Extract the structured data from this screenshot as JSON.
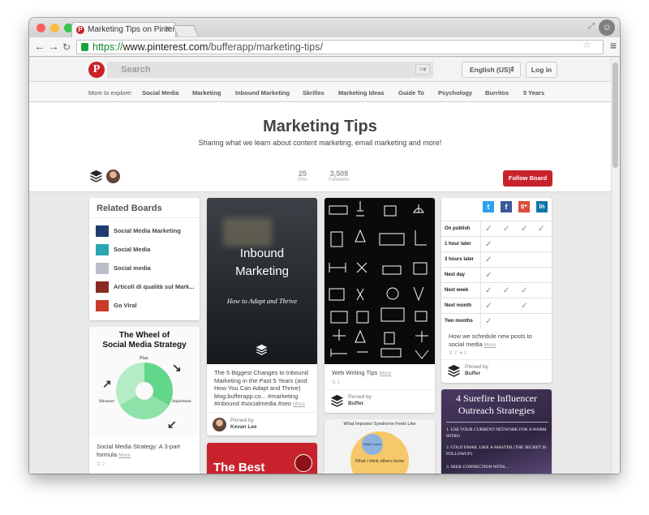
{
  "browser": {
    "tab_title": "Marketing Tips on Pinterest",
    "url_scheme": "https://",
    "url_host": "www.pinterest.com",
    "url_path": "/bufferapp/marketing-tips/"
  },
  "pinterest": {
    "logo": "P",
    "search_placeholder": "Search",
    "language": "English (US)",
    "login_label": "Log in",
    "explore_label": "More to explore:",
    "explore_items": [
      "Social Media",
      "Marketing",
      "Inbound Marketing",
      "Skrillex",
      "Marketing Ideas",
      "Guide To",
      "Psychology",
      "Burritos",
      "5 Years"
    ]
  },
  "board": {
    "title": "Marketing Tips",
    "description": "Sharing what we learn about content marketing, email marketing and more!",
    "pins_count": "25",
    "pins_label": "Pins",
    "followers_count": "3,508",
    "followers_label": "Followers",
    "follow_label": "Follow Board"
  },
  "related": {
    "title": "Related Boards",
    "items": [
      {
        "label": "Social Media Marketing",
        "thumb_color": "#1e3c72"
      },
      {
        "label": "Social Media",
        "thumb_color": "#2aa6b2"
      },
      {
        "label": "Social media",
        "thumb_color": "#b8bfc9"
      },
      {
        "label": "Articoli di qualità sul Mark...",
        "thumb_color": "#8a2a22"
      },
      {
        "label": "Go Viral",
        "thumb_color": "#c83a2a"
      }
    ]
  },
  "wheel": {
    "title_line1": "The Wheel of",
    "title_line2": "Social Media Strategy",
    "plan": "Plan",
    "measure": "Measure",
    "implement": "Implement",
    "caption": "Social Media Strategy: A 3-part formula",
    "more": "More",
    "repins": "2"
  },
  "inbound": {
    "line1": "Inbound",
    "line2": "Marketing",
    "line3": "How to Adapt and Thrive",
    "caption": "The 5 Biggest Changes to Inbound Marketing in the Past 5 Years (and How You Can Adapt and Thrive) blog.bufferapp.co... #marketing #inbound #socialmedia #seo",
    "more": "More",
    "pinned_by": "Pinned by",
    "pinner": "Kevan Lee"
  },
  "bestcard": {
    "title": "The Best"
  },
  "writing": {
    "caption": "Web Writing Tips",
    "more": "More",
    "repins": "1",
    "pinned_by": "Pinned by",
    "pinner": "Buffer"
  },
  "impostor": {
    "title": "What Impostor Syndrome Feels Like",
    "small": "What I know",
    "big": "What I think others know"
  },
  "schedule": {
    "social": [
      "t",
      "f",
      "g+",
      "in"
    ],
    "social_colors": [
      "#2aa3ef",
      "#3b5998",
      "#dd4b39",
      "#0e76a8"
    ],
    "rows": [
      "On publish",
      "1 hour later",
      "3 hours later",
      "Next day",
      "Next week",
      "Next month",
      "Two months"
    ],
    "caption": "How we schedule new posts to social media",
    "more": "More",
    "repins": "7",
    "likes": "3",
    "pinned_by": "Pinned by",
    "pinner": "Buffer"
  },
  "influencer": {
    "title": "4 Surefire Influencer Outreach Strategies",
    "step1": "1. Use your current network for a warm intro",
    "step2": "2. Cold email like a master (the secret is followup)",
    "step3": "3. Seek connection with..."
  }
}
